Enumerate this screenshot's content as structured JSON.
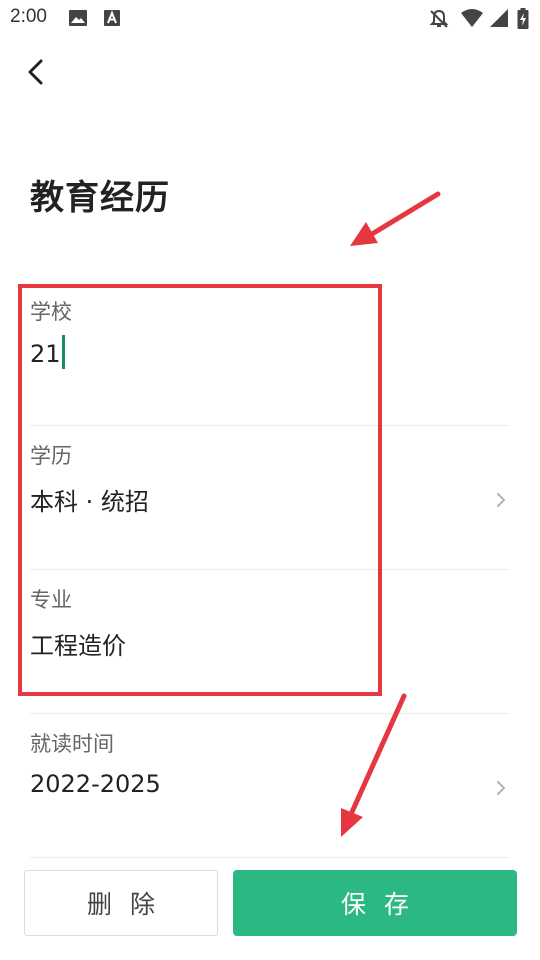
{
  "status_bar": {
    "time": "2:00",
    "left_icons": [
      "image-icon",
      "text-notification-icon"
    ],
    "right_icons": [
      "notifications-off-icon",
      "wifi-icon",
      "signal-icon",
      "battery-charging-icon"
    ]
  },
  "header": {
    "back_icon": "chevron-left-icon"
  },
  "page": {
    "title": "教育经历"
  },
  "form": {
    "school": {
      "label": "学校",
      "value": "21"
    },
    "degree": {
      "label": "学历",
      "value": "本科 · 统招"
    },
    "major": {
      "label": "专业",
      "value": "工程造价"
    },
    "period": {
      "label": "就读时间",
      "value": "2022-2025"
    }
  },
  "actions": {
    "delete_label": "删除",
    "save_label": "保存"
  },
  "colors": {
    "accent": "#2cb882",
    "caret": "#1a8a6a",
    "annotation": "#e5373f"
  }
}
